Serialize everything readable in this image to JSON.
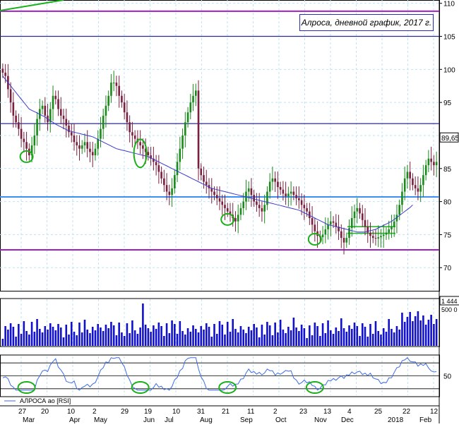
{
  "colors": {
    "grid": "#bfe3f2",
    "price": "#000000",
    "bull_candle": "#1a8a1a",
    "bear_candle": "#7a1f3d",
    "ma": "#3a3ad0",
    "support_blue": "#3a8ef5",
    "purple_line": "#a020c0",
    "navy_line": "#2b2b8f",
    "green_marks": "#19b019",
    "volume": "#1111cc",
    "rsi": "#3a6be8",
    "frame": "#000000"
  },
  "chart_data": {
    "title": "Алроса, дневной график, 2017 г.",
    "type": "candlestick",
    "price_axis": {
      "ticks": [
        70,
        75,
        80,
        85,
        90,
        95,
        100,
        105,
        110
      ],
      "last_price_label": "89.65"
    },
    "volume_axis": {
      "ticks_labels": [
        "1 444",
        "500 0"
      ]
    },
    "rsi_axis": {
      "ticks": [
        50
      ]
    },
    "rsi_legend": "АЛРОСА ао [RSI]",
    "x_axis": {
      "day_labels": [
        "27",
        "20",
        "10",
        "2",
        "29",
        "19",
        "10",
        "31",
        "21",
        "11",
        "2",
        "23",
        "13",
        "4",
        "25",
        "22",
        "12"
      ],
      "month_labels": [
        "Mar",
        "Apr",
        "May",
        "Jun",
        "Jul",
        "Aug",
        "Sep",
        "Oct",
        "Nov",
        "Dec",
        "2018",
        "Feb"
      ]
    },
    "horizontal_levels": [
      {
        "name": "top-purple",
        "value": 108.8
      },
      {
        "name": "navy-105",
        "value": 105
      },
      {
        "name": "navy-91.8",
        "value": 91.8
      },
      {
        "name": "support-blue",
        "value": 80.7
      },
      {
        "name": "bottom-purple",
        "value": 72.7
      }
    ],
    "close_series": [
      99.5,
      99,
      97,
      95,
      93,
      92,
      91,
      89.5,
      89,
      88,
      87,
      88.5,
      90,
      92.5,
      94,
      94.5,
      93,
      92,
      94,
      96,
      95.5,
      94,
      93,
      92.5,
      91.5,
      90.5,
      90,
      89,
      88.5,
      88,
      88.5,
      89,
      88,
      87.5,
      87,
      88,
      89.5,
      91,
      93,
      94.5,
      96,
      98,
      98,
      97.5,
      96,
      95,
      93.5,
      92,
      90.5,
      90,
      89.5,
      89,
      88.5,
      88,
      87.5,
      87,
      86.5,
      86,
      85.5,
      84.5,
      83.5,
      82.5,
      81.5,
      81,
      82,
      84,
      86,
      88,
      90,
      92,
      93.5,
      95,
      96,
      96.8,
      85,
      84,
      83,
      82.5,
      82,
      81.5,
      81,
      80.5,
      80,
      79.5,
      79,
      78.5,
      78,
      77.5,
      77,
      78,
      79,
      80,
      81.5,
      82,
      81,
      80,
      79.5,
      79,
      78.5,
      79.5,
      81.5,
      83,
      83.5,
      83,
      82.2,
      81.8,
      81.2,
      80.8,
      81.2,
      81.5,
      81,
      80.5,
      80.2,
      79.5,
      79,
      78.5,
      77.5,
      76.5,
      75.5,
      74.8,
      74.6,
      75,
      75.8,
      76.5,
      77,
      76.8,
      76.2,
      75.5,
      74.5,
      73.8,
      74.5,
      76,
      77.5,
      78.5,
      79,
      78.2,
      77.2,
      76.2,
      75.3,
      74.8,
      74.5,
      74.4,
      74.6,
      74.8,
      75,
      75.3,
      75.8,
      76.2,
      77,
      78,
      79.5,
      81.5,
      83.5,
      84.5,
      83.5,
      82.5,
      82,
      81.5,
      82.5,
      84,
      85.5,
      86.5,
      86,
      85.5,
      86
    ],
    "ma_series": [
      99,
      98.5,
      98,
      97.5,
      97,
      96.5,
      96,
      95.5,
      95,
      94.5,
      94,
      93.8,
      93.6,
      93.4,
      93.2,
      93,
      92.8,
      92.5,
      92.2,
      92,
      91.7,
      91.5,
      91.3,
      91.1,
      90.9,
      90.7,
      90.6,
      90.5,
      90.4,
      90.3,
      90.2,
      90.1,
      90,
      89.9,
      89.8,
      89.6,
      89.4,
      89.2,
      89,
      88.8,
      88.6,
      88.4,
      88.2,
      88,
      87.9,
      87.8,
      87.7,
      87.6,
      87.5,
      87.4,
      87.3,
      87.2,
      87.1,
      87,
      86.9,
      86.8,
      86.6,
      86.4,
      86.2,
      86,
      85.8,
      85.6,
      85.4,
      85.2,
      85,
      84.8,
      84.6,
      84.4,
      84.2,
      84,
      83.8,
      83.6,
      83.4,
      83.2,
      83,
      82.8,
      82.6,
      82.4,
      82.2,
      82,
      81.9,
      81.8,
      81.7,
      81.6,
      81.5,
      81.4,
      81.3,
      81.2,
      81.1,
      81,
      80.9,
      80.8,
      80.7,
      80.6,
      80.5,
      80.4,
      80.3,
      80.2,
      80.1,
      80,
      79.9,
      79.8,
      79.7,
      79.6,
      79.5,
      79.4,
      79.3,
      79.2,
      79.1,
      79,
      78.9,
      78.8,
      78.7,
      78.5,
      78.3,
      78.1,
      77.9,
      77.7,
      77.5,
      77.3,
      77.1,
      76.9,
      76.7,
      76.5,
      76.4,
      76.3,
      76.2,
      76.1,
      76,
      75.9,
      75.8,
      75.7,
      75.6,
      75.5,
      75.4,
      75.4,
      75.4,
      75.4,
      75.5,
      75.6,
      75.7,
      75.8,
      76,
      76.2,
      76.4,
      76.6,
      76.8,
      77,
      77.3,
      77.6,
      77.9,
      78.2,
      78.5,
      78.8,
      79.1,
      79.5
    ],
    "rsi_level_lines": [
      70,
      50,
      30
    ],
    "highlighted_lows_close_index": [
      9,
      52,
      85,
      118
    ]
  }
}
